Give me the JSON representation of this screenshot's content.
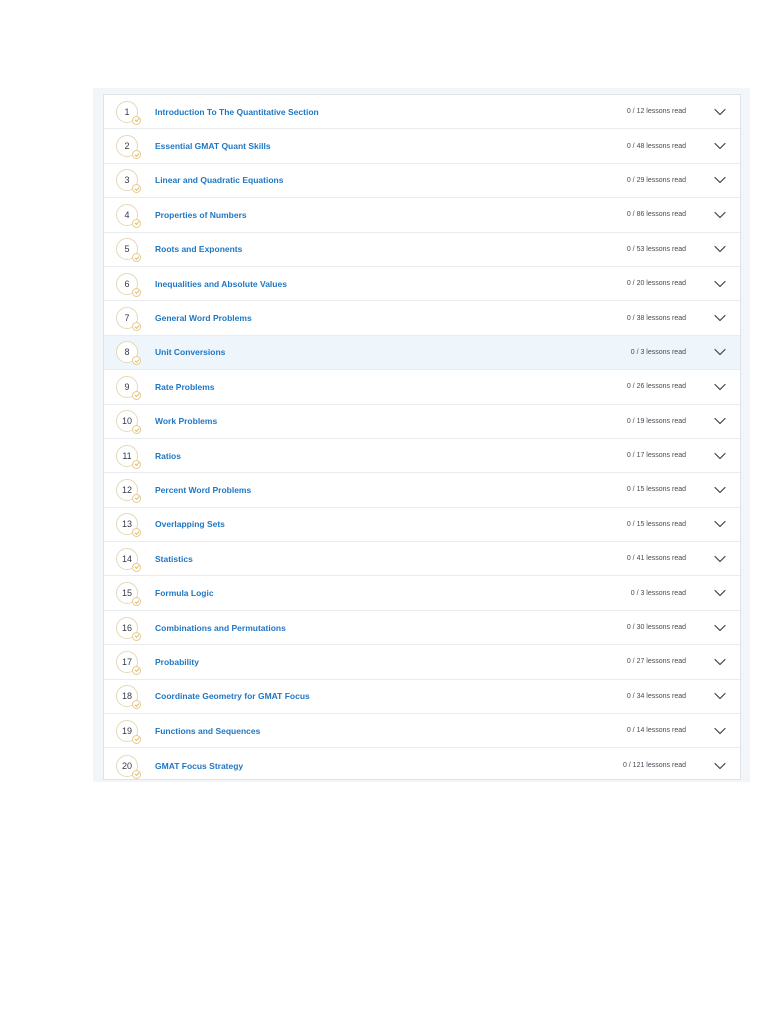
{
  "sections": [
    {
      "number": "1",
      "title": "Introduction To The Quantitative Section",
      "progress": "0 / 12 lessons read"
    },
    {
      "number": "2",
      "title": "Essential GMAT Quant Skills",
      "progress": "0 / 48 lessons read"
    },
    {
      "number": "3",
      "title": "Linear and Quadratic Equations",
      "progress": "0 / 29 lessons read"
    },
    {
      "number": "4",
      "title": "Properties of Numbers",
      "progress": "0 / 86 lessons read"
    },
    {
      "number": "5",
      "title": "Roots and Exponents",
      "progress": "0 / 53 lessons read"
    },
    {
      "number": "6",
      "title": "Inequalities and Absolute Values",
      "progress": "0 / 20 lessons read"
    },
    {
      "number": "7",
      "title": "General Word Problems",
      "progress": "0 / 38 lessons read"
    },
    {
      "number": "8",
      "title": "Unit Conversions",
      "progress": "0 / 3 lessons read"
    },
    {
      "number": "9",
      "title": "Rate Problems",
      "progress": "0 / 26 lessons read"
    },
    {
      "number": "10",
      "title": "Work Problems",
      "progress": "0 / 19 lessons read"
    },
    {
      "number": "11",
      "title": "Ratios",
      "progress": "0 / 17 lessons read"
    },
    {
      "number": "12",
      "title": "Percent Word Problems",
      "progress": "0 / 15 lessons read"
    },
    {
      "number": "13",
      "title": "Overlapping Sets",
      "progress": "0 / 15 lessons read"
    },
    {
      "number": "14",
      "title": "Statistics",
      "progress": "0 / 41 lessons read"
    },
    {
      "number": "15",
      "title": "Formula Logic",
      "progress": "0 / 3 lessons read"
    },
    {
      "number": "16",
      "title": "Combinations and Permutations",
      "progress": "0 / 30 lessons read"
    },
    {
      "number": "17",
      "title": "Probability",
      "progress": "0 / 27 lessons read"
    },
    {
      "number": "18",
      "title": "Coordinate Geometry for GMAT Focus",
      "progress": "0 / 34 lessons read"
    },
    {
      "number": "19",
      "title": "Functions and Sequences",
      "progress": "0 / 14 lessons read"
    },
    {
      "number": "20",
      "title": "GMAT Focus Strategy",
      "progress": "0 / 121 lessons read"
    }
  ],
  "highlighted_index": 7,
  "colors": {
    "title": "#1f77c4",
    "highlight": "#eef5fb",
    "badge_border": "#e4d9b8",
    "check": "#e8c98a"
  },
  "icons": {
    "row_toggle": "chevron-down-icon",
    "badge_mark": "check-icon"
  }
}
